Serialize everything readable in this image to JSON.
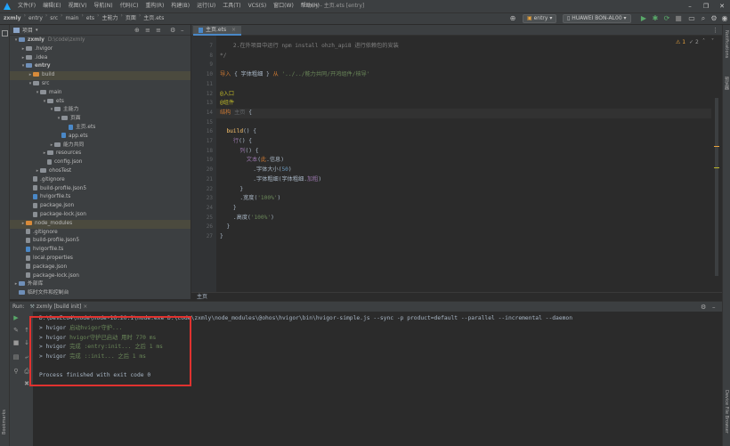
{
  "menu": {
    "items": [
      "文件(F)",
      "编辑(E)",
      "视图(V)",
      "导航(N)",
      "代码(C)",
      "重构(R)",
      "构建(B)",
      "运行(U)",
      "工具(T)",
      "VCS(S)",
      "窗口(W)",
      "帮助(H)"
    ]
  },
  "window_title": "zxmly - 主页.ets [entry]",
  "breadcrumbs": [
    "zxmly",
    "entry",
    "src",
    "main",
    "ets",
    "主能力",
    "页面",
    "主页.ets"
  ],
  "toolbar": {
    "run_config": "entry",
    "device": "HUAWEI BON-AL00"
  },
  "project_panel": {
    "title": "项目",
    "tree": [
      {
        "label": "zxmly",
        "hint": "D:\\code\\zxmly",
        "depth": 0,
        "arrow": "▾",
        "icon": "module"
      },
      {
        "label": ".hvigor",
        "depth": 1,
        "arrow": "▸",
        "icon": "folder"
      },
      {
        "label": ".idea",
        "depth": 1,
        "arrow": "▸",
        "icon": "folder"
      },
      {
        "label": "entry",
        "depth": 1,
        "arrow": "▾",
        "icon": "module"
      },
      {
        "label": "build",
        "depth": 2,
        "arrow": "▸",
        "icon": "folder-orange",
        "selected": true
      },
      {
        "label": "src",
        "depth": 2,
        "arrow": "▾",
        "icon": "folder"
      },
      {
        "label": "main",
        "depth": 3,
        "arrow": "▾",
        "icon": "folder"
      },
      {
        "label": "ets",
        "depth": 4,
        "arrow": "▾",
        "icon": "folder"
      },
      {
        "label": "主能力",
        "depth": 5,
        "arrow": "▾",
        "icon": "folder"
      },
      {
        "label": "页面",
        "depth": 6,
        "arrow": "▾",
        "icon": "folder"
      },
      {
        "label": "主页.ets",
        "depth": 7,
        "arrow": "",
        "icon": "file-blue"
      },
      {
        "label": "app.ets",
        "depth": 6,
        "arrow": "",
        "icon": "file-blue"
      },
      {
        "label": "能力共同",
        "depth": 5,
        "arrow": "▸",
        "icon": "folder"
      },
      {
        "label": "resources",
        "depth": 4,
        "arrow": "▸",
        "icon": "folder"
      },
      {
        "label": "config.json",
        "depth": 4,
        "arrow": "",
        "icon": "file-gray"
      },
      {
        "label": "ohosTest",
        "depth": 3,
        "arrow": "▸",
        "icon": "folder"
      },
      {
        "label": ".gitignore",
        "depth": 2,
        "arrow": "",
        "icon": "file-gray"
      },
      {
        "label": "build-profile.json5",
        "depth": 2,
        "arrow": "",
        "icon": "file-gray"
      },
      {
        "label": "hvigorfile.ts",
        "depth": 2,
        "arrow": "",
        "icon": "file-blue"
      },
      {
        "label": "package.json",
        "depth": 2,
        "arrow": "",
        "icon": "file-gray"
      },
      {
        "label": "package-lock.json",
        "depth": 2,
        "arrow": "",
        "icon": "file-gray"
      },
      {
        "label": "node_modules",
        "depth": 1,
        "arrow": "▸",
        "icon": "folder-orange",
        "selected": true
      },
      {
        "label": ".gitignore",
        "depth": 1,
        "arrow": "",
        "icon": "file-gray"
      },
      {
        "label": "build-profile.json5",
        "depth": 1,
        "arrow": "",
        "icon": "file-gray"
      },
      {
        "label": "hvigorfile.ts",
        "depth": 1,
        "arrow": "",
        "icon": "file-blue"
      },
      {
        "label": "local.properties",
        "depth": 1,
        "arrow": "",
        "icon": "file-gray"
      },
      {
        "label": "package.json",
        "depth": 1,
        "arrow": "",
        "icon": "file-gray"
      },
      {
        "label": "package-lock.json",
        "depth": 1,
        "arrow": "",
        "icon": "file-gray"
      },
      {
        "label": "外部库",
        "depth": 0,
        "arrow": "▸",
        "icon": "lib"
      },
      {
        "label": "临时文件和控制台",
        "depth": 0,
        "arrow": "",
        "icon": "lib"
      }
    ]
  },
  "editor": {
    "tab": "主页.ets",
    "warning_count": "1",
    "check_count": "2",
    "lines": [
      {
        "no": "7",
        "parts": [
          {
            "t": "    2.在外项目中运行 npm install ",
            "c": "c"
          },
          {
            "t": "ohzh",
            "c": "c"
          },
          {
            "t": "_api8 进行依赖包的安装",
            "c": "c"
          }
        ]
      },
      {
        "no": "8",
        "parts": [
          {
            "t": "*/",
            "c": "c"
          }
        ]
      },
      {
        "no": "9",
        "parts": [
          {
            "t": "",
            "c": "i"
          }
        ]
      },
      {
        "no": "10",
        "parts": [
          {
            "t": "导入 ",
            "c": "k"
          },
          {
            "t": "{ 字体粗细 } ",
            "c": "i"
          },
          {
            "t": "从 ",
            "c": "k"
          },
          {
            "t": "'../../能力共同/开鸿组件/核导'",
            "c": "s"
          }
        ]
      },
      {
        "no": "11",
        "parts": [
          {
            "t": "",
            "c": "i"
          }
        ]
      },
      {
        "no": "12",
        "parts": [
          {
            "t": "@入口",
            "c": "a"
          }
        ]
      },
      {
        "no": "13",
        "parts": [
          {
            "t": "@组件",
            "c": "a"
          }
        ]
      },
      {
        "no": "14",
        "parts": [
          {
            "t": "结构 ",
            "c": "k"
          },
          {
            "t": "主页 ",
            "c": "g"
          },
          {
            "t": "{",
            "c": "i"
          }
        ]
      },
      {
        "no": "15",
        "parts": [
          {
            "t": "",
            "c": "i"
          }
        ]
      },
      {
        "no": "16",
        "parts": [
          {
            "t": "  build",
            "c": "f"
          },
          {
            "t": "() {",
            "c": "i"
          }
        ]
      },
      {
        "no": "17",
        "parts": [
          {
            "t": "    行",
            "c": "p"
          },
          {
            "t": "() {",
            "c": "i"
          }
        ]
      },
      {
        "no": "18",
        "parts": [
          {
            "t": "      列",
            "c": "p"
          },
          {
            "t": "() {",
            "c": "i"
          }
        ]
      },
      {
        "no": "19",
        "parts": [
          {
            "t": "        文本",
            "c": "p"
          },
          {
            "t": "(",
            "c": "i"
          },
          {
            "t": "此",
            "c": "k"
          },
          {
            "t": ".信息)",
            "c": "i"
          }
        ]
      },
      {
        "no": "20",
        "parts": [
          {
            "t": "          .字体大小(",
            "c": "i"
          },
          {
            "t": "50",
            "c": "n"
          },
          {
            "t": ")",
            "c": "i"
          }
        ]
      },
      {
        "no": "21",
        "parts": [
          {
            "t": "          .字体粗细(字体粗细.",
            "c": "i"
          },
          {
            "t": "加粗",
            "c": "p"
          },
          {
            "t": ")",
            "c": "i"
          }
        ]
      },
      {
        "no": "22",
        "parts": [
          {
            "t": "      }",
            "c": "i"
          }
        ]
      },
      {
        "no": "23",
        "parts": [
          {
            "t": "      .宽度(",
            "c": "i"
          },
          {
            "t": "'100%'",
            "c": "s"
          },
          {
            "t": ")",
            "c": "i"
          }
        ]
      },
      {
        "no": "24",
        "parts": [
          {
            "t": "    }",
            "c": "i"
          }
        ]
      },
      {
        "no": "25",
        "parts": [
          {
            "t": "    .高度(",
            "c": "i"
          },
          {
            "t": "'100%'",
            "c": "s"
          },
          {
            "t": ")",
            "c": "i"
          }
        ]
      },
      {
        "no": "26",
        "parts": [
          {
            "t": "  }",
            "c": "i"
          }
        ]
      },
      {
        "no": "27",
        "parts": [
          {
            "t": "}",
            "c": "i"
          }
        ]
      }
    ],
    "status_breadcrumb": "主页"
  },
  "run_panel": {
    "label": "Run:",
    "tab": "zxmly [build init]",
    "command": "D:\\DevEco4\\node\\node-16.20.1\\node.exe D:\\code\\zxmly\\node_modules\\@ohos\\hvigor\\bin\\hvigor-simple.js --sync -p product=default --parallel --incremental --daemon",
    "output": [
      {
        "prefix": "> hvigor ",
        "text": "启动hvigor守护...",
        "c": "g"
      },
      {
        "prefix": "> hvigor ",
        "text": "hvigor守护已启动 用时 770 ms",
        "c": "g"
      },
      {
        "prefix": "> hvigor ",
        "text": "完成 :entry:init... 之后 1 ms",
        "c": "g"
      },
      {
        "prefix": "> hvigor ",
        "text": "完成 ::init... 之后 1 ms",
        "c": "g"
      }
    ],
    "finish": "Process finished with exit code 0"
  },
  "left_strip": {
    "bookmarks": "Bookmarks",
    "structure": "结构"
  },
  "right_strip": {
    "notifications": "Notifications",
    "previewer": "预览器",
    "device_file_browser": "Device File Browser"
  }
}
